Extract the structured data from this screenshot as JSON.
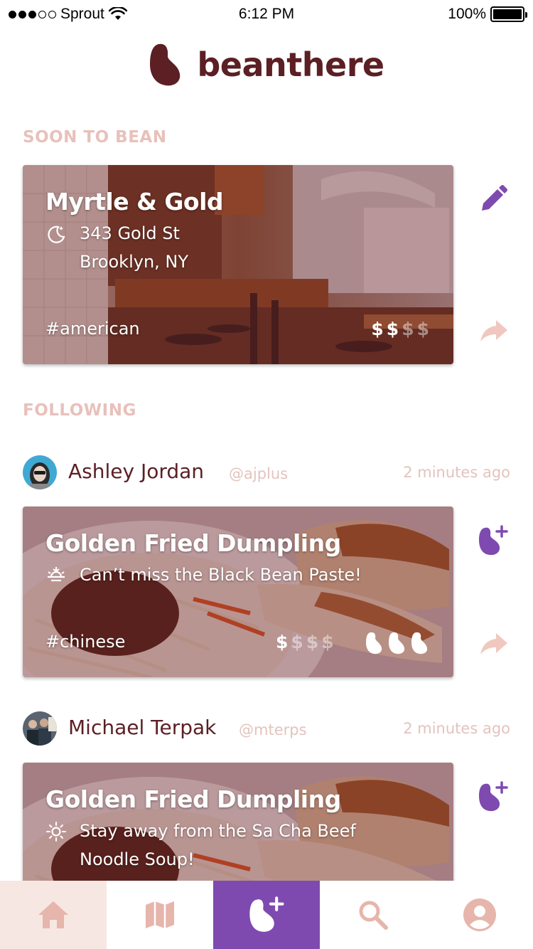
{
  "status_bar": {
    "carrier": "Sprout",
    "time": "6:12 PM",
    "battery": "100%"
  },
  "app": {
    "name": "beanthere"
  },
  "sections": {
    "soon": "SOON TO BEAN",
    "following": "FOLLOWING"
  },
  "soon_card": {
    "title": "Myrtle & Gold",
    "address_line1": "343 Gold St",
    "address_line2": "Brooklyn, NY",
    "tag": "#american",
    "price_level": 2,
    "price_max": 4
  },
  "posts": [
    {
      "user_name": "Ashley Jordan",
      "handle": "@ajplus",
      "time": "2 minutes ago",
      "title": "Golden Fried Dumpling",
      "comment": "Can’t miss the Black Bean Paste!",
      "tag": "#chinese",
      "price_level": 1,
      "price_max": 4,
      "bean_rating": 3
    },
    {
      "user_name": "Michael Terpak",
      "handle": "@mterps",
      "time": "2 minutes ago",
      "title": "Golden Fried Dumpling",
      "comment_line1": "Stay away from the Sa Cha Beef",
      "comment_line2": "Noodle Soup!"
    }
  ],
  "icons": {
    "edit": "pencil-icon",
    "share": "share-arrow-icon",
    "add_bean": "bean-plus-icon",
    "night": "moon-stars-icon",
    "sunset": "sunset-icon",
    "sun": "sun-icon"
  },
  "tabs": [
    "home",
    "map",
    "add-bean",
    "search",
    "profile"
  ],
  "colors": {
    "brand": "#5b1f24",
    "accent": "#7e4ab0",
    "muted": "#e8c1bb"
  }
}
